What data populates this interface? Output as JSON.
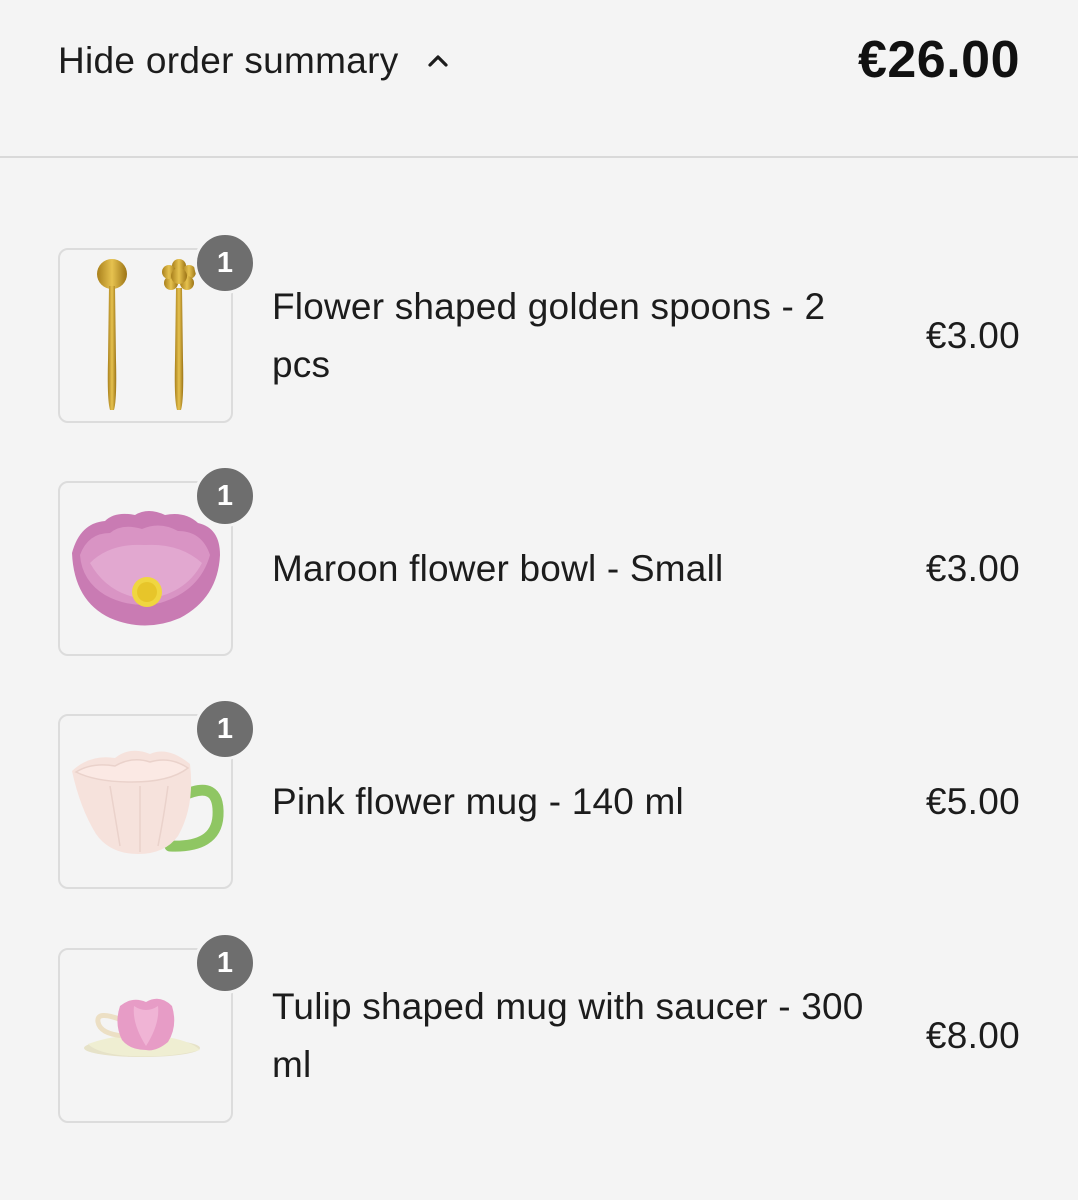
{
  "summary": {
    "toggle_label": "Hide order summary",
    "toggle_icon": "chevron-up-icon",
    "total": "€26.00"
  },
  "items": [
    {
      "name": "Flower shaped golden spoons - 2 pcs",
      "price": "€3.00",
      "quantity": "1",
      "image": "golden-spoons-image"
    },
    {
      "name": "Maroon flower bowl - Small",
      "price": "€3.00",
      "quantity": "1",
      "image": "flower-bowl-image"
    },
    {
      "name": "Pink flower mug - 140 ml",
      "price": "€5.00",
      "quantity": "1",
      "image": "flower-mug-image"
    },
    {
      "name": "Tulip shaped mug with saucer - 300 ml",
      "price": "€8.00",
      "quantity": "1",
      "image": "tulip-mug-image"
    }
  ],
  "colors": {
    "background": "#f4f4f4",
    "badge": "#6e6e6e",
    "divider": "#d9d9d9"
  }
}
